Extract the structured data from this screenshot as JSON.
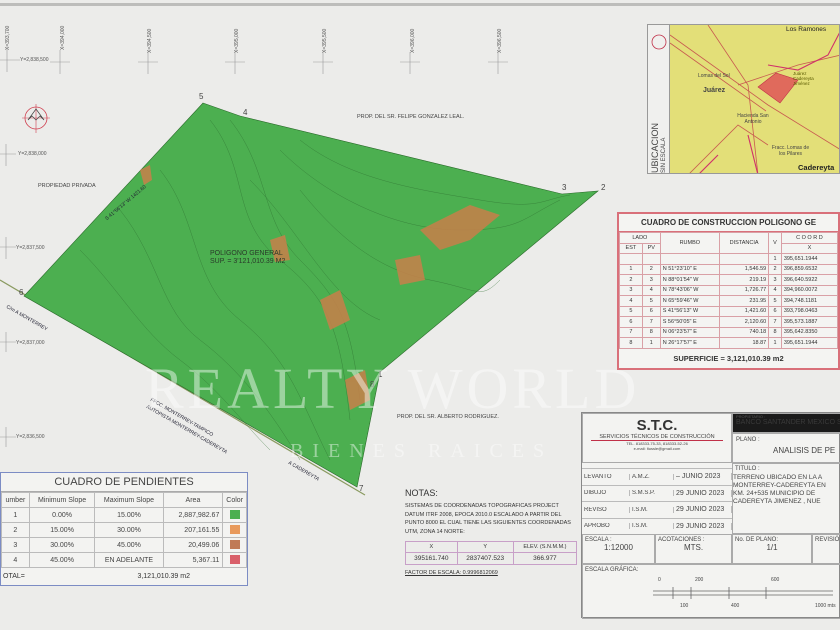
{
  "grid": {
    "x_labels": [
      "X=393,700",
      "X=394,000",
      "X=394,500",
      "X=395,000",
      "X=395,500",
      "X=396,000",
      "X=396,500"
    ],
    "y_labels": [
      "Y=2,838,500",
      "Y=2,838,000",
      "Y=2,837,500",
      "Y=2,837,000",
      "Y=2,836,500"
    ]
  },
  "north_label": "NORTE",
  "map": {
    "polygon_title": "POLIGONO GENERAL",
    "polygon_area": "SUP. = 3'121,010.39 M2",
    "vertices": [
      "1",
      "2",
      "3",
      "4",
      "5",
      "6",
      "7",
      "8"
    ],
    "labels": {
      "prop_north": "PROP. DEL SR. FELIPE GONZALEZ LEAL.",
      "prop_west": "PROPIEDAD PRIVADA",
      "prop_east": "PROP. DEL SR. ALBERTO RODRIGUEZ.",
      "road_monterrey": "C/m A MONTERREY",
      "ffcc": "FFCC. MONTERREY-TAMPICO",
      "autopista": "AUTOPISTA MONTERREY-CADEREYTA",
      "cadereyta": "A CADEREYTA",
      "edge_5_6": "S 41°56'13\" W 1421.60"
    },
    "colors": {
      "flat": "#4caf50",
      "slope": "#c8804a"
    }
  },
  "location": {
    "title": "UBICACION",
    "subtitle": "SIN ESCALA",
    "places": [
      "Lomas del Sol",
      "Juárez",
      "Hacienda San Antonio",
      "Fracc. Lomas de los Pilares",
      "Cadereyta",
      "Los Ramones",
      "Juárez Cadereyta Jiménez"
    ]
  },
  "construction": {
    "title": "CUADRO DE CONSTRUCCION POLIGONO GE",
    "headers": {
      "lado": "LADO",
      "est": "EST",
      "pv": "PV",
      "rumbo": "RUMBO",
      "distancia": "DISTANCIA",
      "v": "V",
      "coord": "C O O R D",
      "x": "X"
    },
    "rows": [
      {
        "est": "",
        "pv": "",
        "rumbo": "",
        "dist": "",
        "v": "1",
        "x": "395,651.1944"
      },
      {
        "est": "1",
        "pv": "2",
        "rumbo": "N 51°23'10\" E",
        "dist": "1,546.59",
        "v": "2",
        "x": "396,859.6532"
      },
      {
        "est": "2",
        "pv": "3",
        "rumbo": "N 88°01'54\" W",
        "dist": "219.19",
        "v": "3",
        "x": "396,640.5922"
      },
      {
        "est": "3",
        "pv": "4",
        "rumbo": "N 78°43'06\" W",
        "dist": "1,726.77",
        "v": "4",
        "x": "394,960.0072"
      },
      {
        "est": "4",
        "pv": "5",
        "rumbo": "N 65°59'46\" W",
        "dist": "231.95",
        "v": "5",
        "x": "394,748.1181"
      },
      {
        "est": "5",
        "pv": "6",
        "rumbo": "S 41°56'13\" W",
        "dist": "1,421.60",
        "v": "6",
        "x": "393,798.0463"
      },
      {
        "est": "6",
        "pv": "7",
        "rumbo": "S 56°50'05\" E",
        "dist": "2,120.60",
        "v": "7",
        "x": "395,573.1887"
      },
      {
        "est": "7",
        "pv": "8",
        "rumbo": "N 06°23'57\" E",
        "dist": "740.18",
        "v": "8",
        "x": "395,642.8350"
      },
      {
        "est": "8",
        "pv": "1",
        "rumbo": "N 26°17'57\" E",
        "dist": "18.87",
        "v": "1",
        "x": "395,651.1944"
      }
    ],
    "superficie": "SUPERFICIE = 3,121,010.39 m2"
  },
  "slopes": {
    "title": "CUADRO DE PENDIENTES",
    "headers": [
      "umber",
      "Minimum Slope",
      "Maximum Slope",
      "Area",
      "Color"
    ],
    "rows": [
      {
        "n": "1",
        "min": "0.00%",
        "max": "15.00%",
        "area": "2,887,982.67",
        "color": "#4caf50"
      },
      {
        "n": "2",
        "min": "15.00%",
        "max": "30.00%",
        "area": "207,161.55",
        "color": "#e89a5c"
      },
      {
        "n": "3",
        "min": "30.00%",
        "max": "45.00%",
        "area": "20,499.06",
        "color": "#c07a56"
      },
      {
        "n": "4",
        "min": "45.00%",
        "max": "EN ADELANTE",
        "area": "5,367.11",
        "color": "#d9606a"
      }
    ],
    "total_label": "OTAL=",
    "total_value": "3,121,010.39  m2"
  },
  "notes": {
    "title": "NOTAS:",
    "text": "SISTEMAS DE COORDENADAS TOPOGRAFICAS PROJECT DATUM ITRF 2008, EPOCA 2010.0 ESCALADO A PARTIR DEL PUNTO 8000 EL CUAL TIENE LAS SIGUIENTES COORDENADAS UTM, ZONA 14 NORTE:",
    "headers": [
      "X",
      "Y",
      "ELEV. (S.N.M.M.)"
    ],
    "values": [
      "395161.740",
      "2837407.523",
      "366.977"
    ],
    "factor": "FACTOR DE ESCALA: 0.9996812069"
  },
  "title_block": {
    "logo": "S.T.C.",
    "company": "SERVICIOS TÉCNICOS DE CONSTRUCCIÓN",
    "tel": "TEL. 818333-75-33, 818333-52-26",
    "email": "e-mail: ltussle@gmail.com",
    "owner_label": "PROPIETARIO :",
    "owner": "BANCO SANTANDER MEXICO S",
    "plano_label": "PLANO :",
    "plano": "ANALISIS DE PE",
    "titulo_label": "TITULO :",
    "titulo": [
      "TERRENO UBICADO EN LA A",
      "MONTERREY-CADEREYTA EN",
      "KM. 24+535 MUNICIPIO DE",
      "CADEREYTA JIMENEZ , NUE"
    ],
    "signoffs": [
      {
        "role": "LEVANTÓ",
        "who": "A.M.Z.",
        "date": "– JUNIO 2023"
      },
      {
        "role": "DIBUJÓ",
        "who": "S.M.S.P.",
        "date": "29 JUNIO 2023"
      },
      {
        "role": "REVISÓ",
        "who": "I.S.M.",
        "date": "29 JUNIO 2023"
      },
      {
        "role": "APROBÓ",
        "who": "I.S.M.",
        "date": "29 JUNIO 2023"
      }
    ],
    "escala_label": "ESCALA :",
    "escala": "1:12000",
    "acot_label": "ACOTACIONES :",
    "acot": "MTS.",
    "noplano_label": "No. DE PLANO:",
    "noplano": "1/1",
    "revision_label": "REVISIÓ",
    "grafica_label": "ESCALA GRÁFICA:",
    "scale_ticks_top": [
      "0",
      "200",
      "600"
    ],
    "scale_ticks_bottom": [
      "100",
      "400",
      "1000 mts"
    ]
  },
  "watermark": {
    "brand": "REALTY WORLD",
    "sub": "BIENES RAICES"
  }
}
